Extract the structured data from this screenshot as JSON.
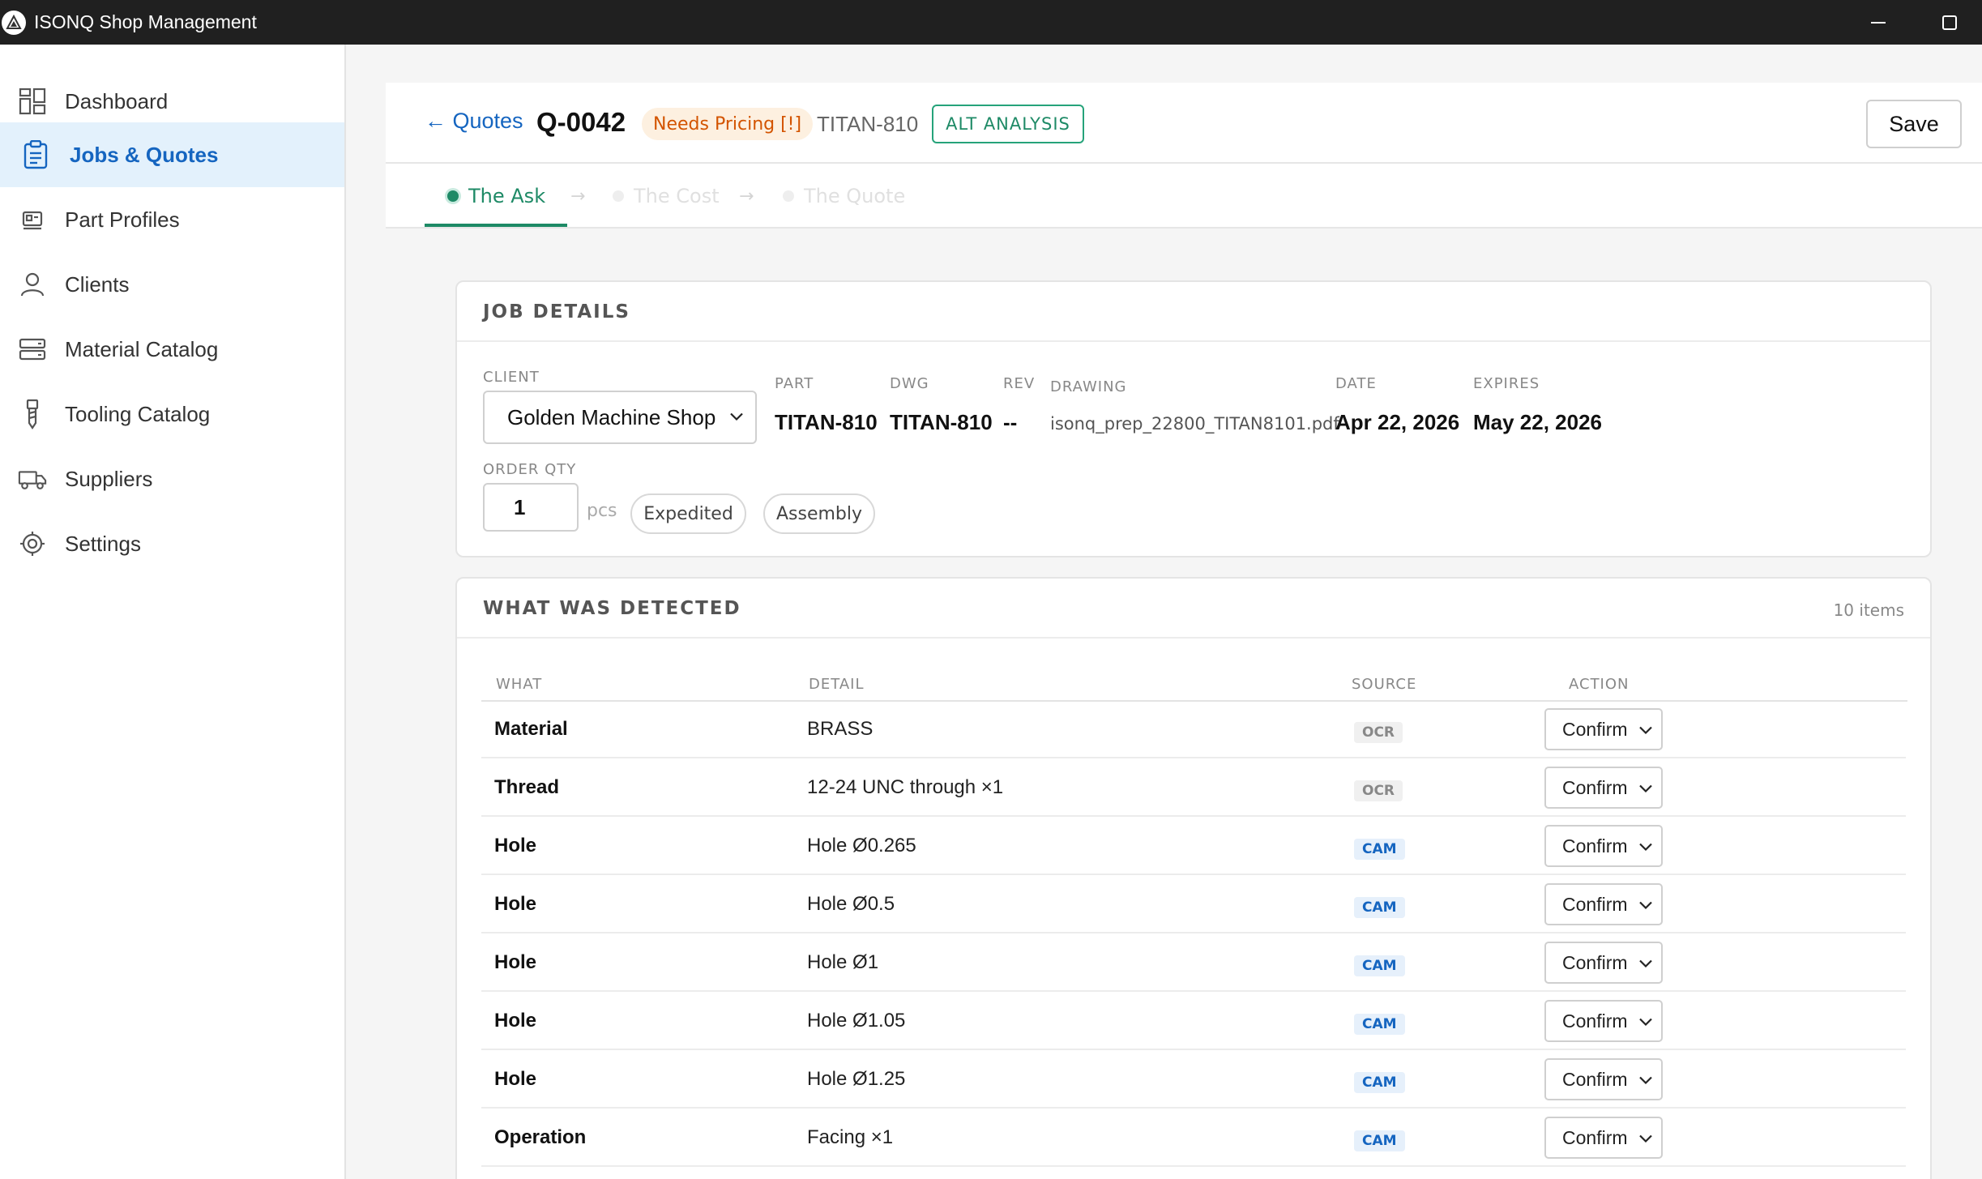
{
  "window": {
    "title": "ISONQ Shop Management",
    "minimize_icon": "minimize-icon",
    "maximize_icon": "maximize-icon"
  },
  "sidebar": {
    "items": [
      {
        "label": "Dashboard",
        "icon": "dashboard-icon",
        "active": false
      },
      {
        "label": "Jobs & Quotes",
        "icon": "clipboard-icon",
        "active": true
      },
      {
        "label": "Part Profiles",
        "icon": "part-profile-icon",
        "active": false
      },
      {
        "label": "Clients",
        "icon": "person-icon",
        "active": false
      },
      {
        "label": "Material Catalog",
        "icon": "material-icon",
        "active": false
      },
      {
        "label": "Tooling Catalog",
        "icon": "tool-icon",
        "active": false
      },
      {
        "label": "Suppliers",
        "icon": "truck-icon",
        "active": false
      },
      {
        "label": "Settings",
        "icon": "gear-icon",
        "active": false
      }
    ]
  },
  "header": {
    "back_label": "← Quotes",
    "quote_id": "Q-0042",
    "status_badge": "Needs Pricing [!]",
    "part_ref": "TITAN-810",
    "alt_analysis_label": "ALT ANALYSIS",
    "save_label": "Save"
  },
  "steps": [
    {
      "label": "The Ask",
      "state": "active"
    },
    {
      "label": "The Cost",
      "state": "inactive"
    },
    {
      "label": "The Quote",
      "state": "inactive"
    }
  ],
  "step_separator": "→",
  "job_details": {
    "title": "JOB DETAILS",
    "client_label": "CLIENT",
    "client_value": "Golden Machine Shop",
    "part_label": "PART",
    "part_value": "TITAN-810",
    "dwg_label": "DWG",
    "dwg_value": "TITAN-810",
    "rev_label": "REV",
    "rev_value": "--",
    "drawing_label": "DRAWING",
    "drawing_value": "isonq_prep_22800_TITAN8101.pdf",
    "date_label": "DATE",
    "date_value": "Apr 22, 2026",
    "expires_label": "EXPIRES",
    "expires_value": "May 22, 2026",
    "order_qty_label": "ORDER QTY",
    "order_qty_value": "1",
    "qty_unit": "pcs",
    "tags": [
      "Expedited",
      "Assembly"
    ]
  },
  "detected": {
    "title": "WHAT WAS DETECTED",
    "count_label": "10 items",
    "columns": [
      "WHAT",
      "DETAIL",
      "SOURCE",
      "ACTION"
    ],
    "rows": [
      {
        "what": "Material",
        "detail": "BRASS",
        "source": "OCR",
        "action": "Confirm"
      },
      {
        "what": "Thread",
        "detail": "12-24 UNC through ×1",
        "source": "OCR",
        "action": "Confirm"
      },
      {
        "what": "Hole",
        "detail": "Hole Ø0.265",
        "source": "CAM",
        "action": "Confirm"
      },
      {
        "what": "Hole",
        "detail": "Hole Ø0.5",
        "source": "CAM",
        "action": "Confirm"
      },
      {
        "what": "Hole",
        "detail": "Hole Ø1",
        "source": "CAM",
        "action": "Confirm"
      },
      {
        "what": "Hole",
        "detail": "Hole Ø1.05",
        "source": "CAM",
        "action": "Confirm"
      },
      {
        "what": "Hole",
        "detail": "Hole Ø1.25",
        "source": "CAM",
        "action": "Confirm"
      },
      {
        "what": "Operation",
        "detail": "Facing ×1",
        "source": "CAM",
        "action": "Confirm"
      }
    ]
  }
}
